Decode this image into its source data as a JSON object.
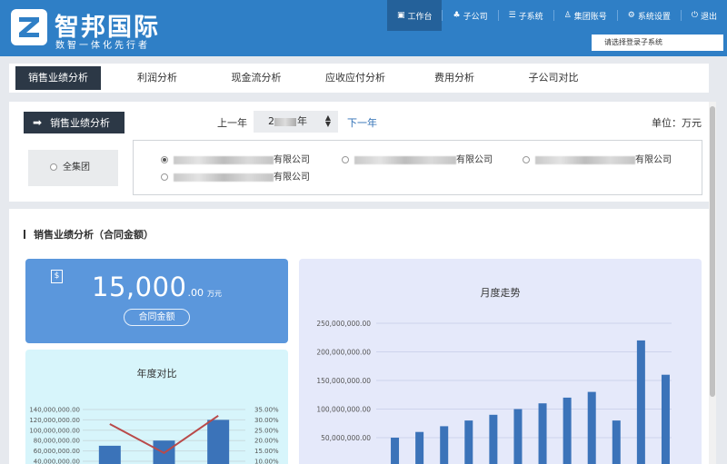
{
  "brand": {
    "title": "智邦国际",
    "subtitle": "数智一体化先行者",
    "logo_letter": "Z"
  },
  "topnav": [
    {
      "icon": "monitor-icon",
      "glyph": "▣",
      "label": "工作台",
      "active": true
    },
    {
      "icon": "org-icon",
      "glyph": "♣",
      "label": "子公司",
      "active": false
    },
    {
      "icon": "list-icon",
      "glyph": "☰",
      "label": "子系统",
      "active": false
    },
    {
      "icon": "user-icon",
      "glyph": "♙",
      "label": "集团账号",
      "active": false
    },
    {
      "icon": "gear-icon",
      "glyph": "⚙",
      "label": "系统设置",
      "active": false
    },
    {
      "icon": "power-icon",
      "glyph": "⏻",
      "label": "退出",
      "active": false
    }
  ],
  "subsystem_select": "请选择登录子系统",
  "tabs": [
    {
      "label": "销售业绩分析",
      "active": true
    },
    {
      "label": "利润分析",
      "active": false
    },
    {
      "label": "现金流分析",
      "active": false
    },
    {
      "label": "应收应付分析",
      "active": false
    },
    {
      "label": "费用分析",
      "active": false
    },
    {
      "label": "子公司对比",
      "active": false
    }
  ],
  "filter": {
    "section_label": "销售业绩分析",
    "prev_year": "上一年",
    "year_prefix": "2",
    "year_suffix": "年",
    "next_year": "下一年",
    "unit": "单位：万元",
    "group_option": "全集团",
    "companies": [
      {
        "suffix": "有限公司",
        "checked": true
      },
      {
        "suffix": "有限公司",
        "checked": false
      },
      {
        "suffix": "有限公司",
        "checked": false
      },
      {
        "suffix": "有限公司",
        "checked": false
      }
    ]
  },
  "main": {
    "title": "销售业绩分析（合同金额）",
    "amount": {
      "integer": "15,000",
      "decimal": ".00",
      "unit": "万元",
      "label": "合同金额"
    },
    "year_chart_title": "年度对比",
    "month_chart_title": "月度走势"
  },
  "chart_data": [
    {
      "type": "bar",
      "title": "年度对比",
      "left_axis_ticks": [
        "140,000,000.00",
        "120,000,000.00",
        "100,000,000.00",
        "80,000,000.00",
        "60,000,000.00",
        "40,000,000.00"
      ],
      "right_axis_ticks": [
        "35.00%",
        "30.00%",
        "25.00%",
        "20.00%",
        "15.00%",
        "10.00%"
      ],
      "ylim": [
        40000000,
        140000000
      ],
      "y2lim": [
        10,
        35
      ],
      "series": [
        {
          "type": "bar",
          "values": [
            70000000,
            80000000,
            120000000
          ]
        },
        {
          "type": "line",
          "values": [
            28,
            14,
            32
          ]
        }
      ],
      "colors": {
        "bar": "#3b73b9",
        "line": "#b94a4a"
      }
    },
    {
      "type": "bar",
      "title": "月度走势",
      "y_ticks": [
        "250,000,000.00",
        "200,000,000.00",
        "150,000,000.00",
        "100,000,000.00",
        "50,000,000.00"
      ],
      "ylim": [
        0,
        250000000
      ],
      "values": [
        50000000,
        60000000,
        70000000,
        80000000,
        90000000,
        100000000,
        110000000,
        120000000,
        130000000,
        80000000,
        220000000,
        160000000
      ],
      "colors": {
        "bar": "#3b73b9"
      }
    }
  ]
}
